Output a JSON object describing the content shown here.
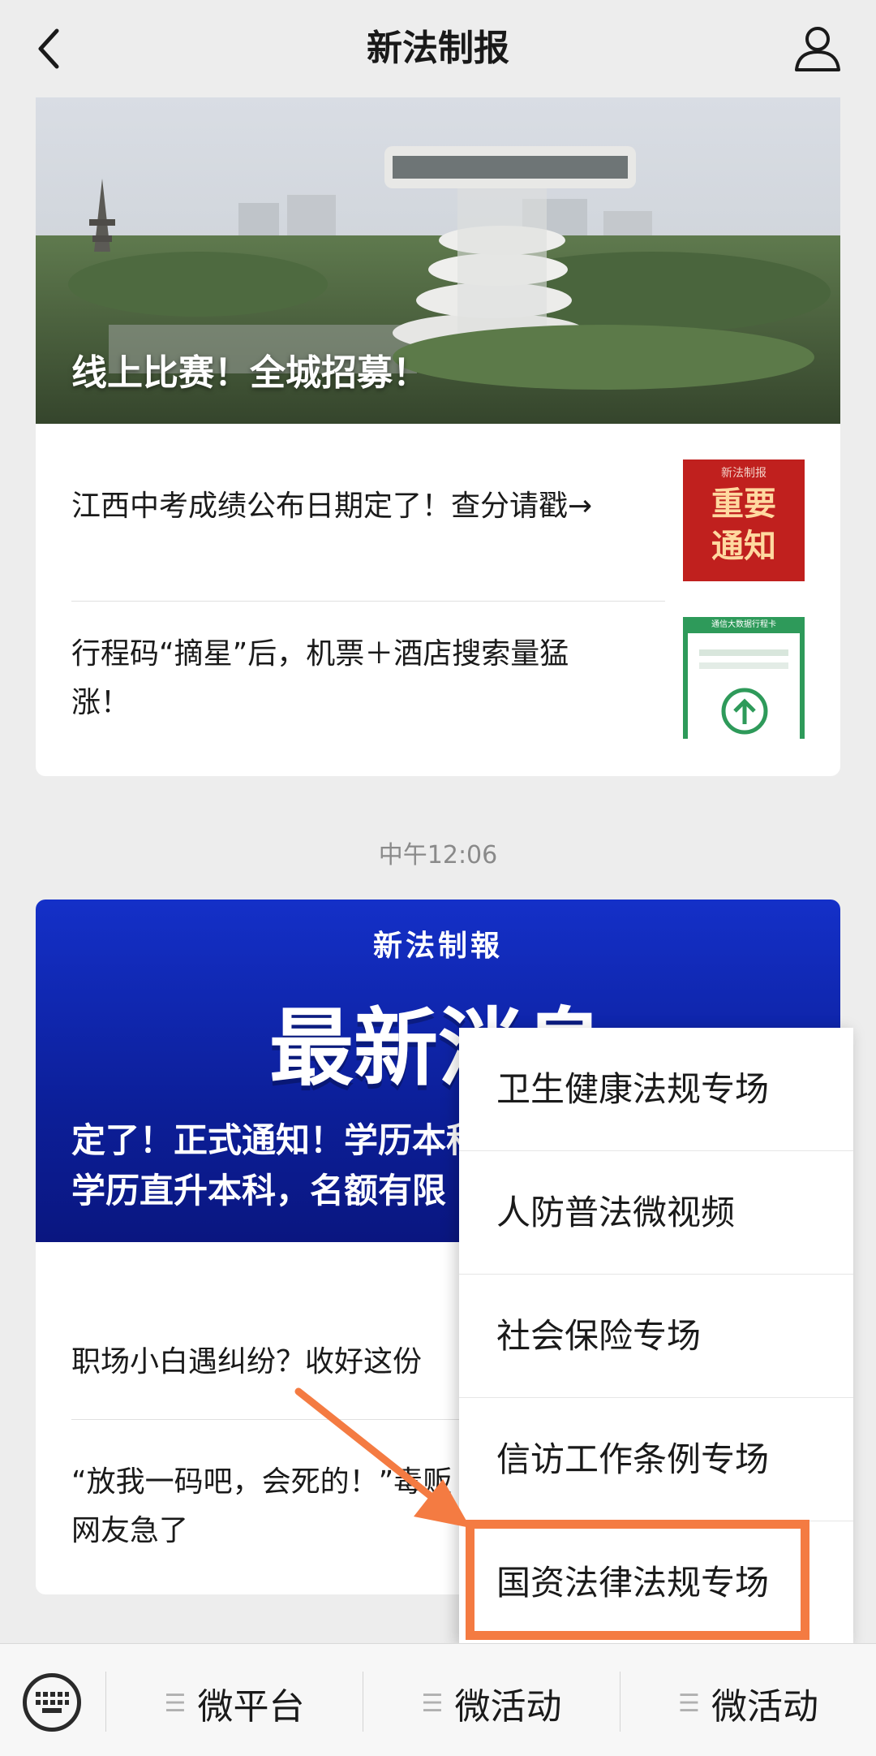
{
  "nav": {
    "title": "新法制报"
  },
  "card1": {
    "hero_caption": "线上比赛！全城招募！",
    "items": [
      {
        "title": "江西中考成绩公布日期定了！查分请戳→",
        "thumb_brand": "新法制报",
        "thumb_line1": "重要",
        "thumb_line2": "通知"
      },
      {
        "title_line1": "行程码“摘星”后，机票＋酒店搜索量猛",
        "title_line2": "涨！",
        "thumb_header": "通信大数据行程卡"
      }
    ]
  },
  "timestamp": "中午12:06",
  "card2": {
    "brand": "新法制報",
    "big_title": "最新消息",
    "line1": "定了！正式通知！学历本科",
    "line2": "学历直升本科，名额有限",
    "items": [
      {
        "title": "职场小白遇纠纷？收好这份"
      },
      {
        "title_line1": "“放我一码吧，会死的！”毒贩",
        "title_line2": "网友急了"
      }
    ]
  },
  "popup": {
    "items": [
      "卫生健康法规专场",
      "人防普法微视频",
      "社会保险专场",
      "信访工作条例专场",
      "国资法律法规专场"
    ],
    "highlighted_index": 4,
    "highlight_color": "#f47b42"
  },
  "bottom_bar": {
    "menus": [
      "微平台",
      "微活动",
      "微活动"
    ],
    "keyboard_icon": "keyboard-icon"
  },
  "colors": {
    "accent_blue": "#1430c8",
    "notice_red": "#c0201e",
    "arrow_orange": "#f47b42",
    "page_bg": "#ededed"
  }
}
